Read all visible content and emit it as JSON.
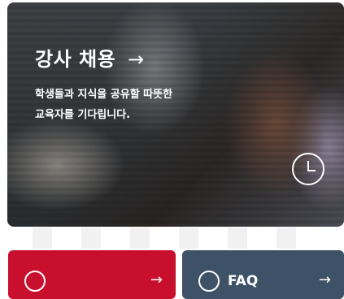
{
  "hero": {
    "title": "강사 채용",
    "title_arrow": "→",
    "description_line1": "학생들과 지식을 공유할 따뜻한",
    "description_line2": "교육자를 기다립니다."
  },
  "icons": {
    "hero_clock": "clock-icon",
    "red_button": "check-circle-icon",
    "blue_button": "help-circle-icon"
  },
  "buttons": {
    "red": {
      "label": "",
      "arrow": "→",
      "color": "#c8102e"
    },
    "blue": {
      "label": "FAQ",
      "arrow": "→",
      "color": "#3d5266"
    }
  }
}
